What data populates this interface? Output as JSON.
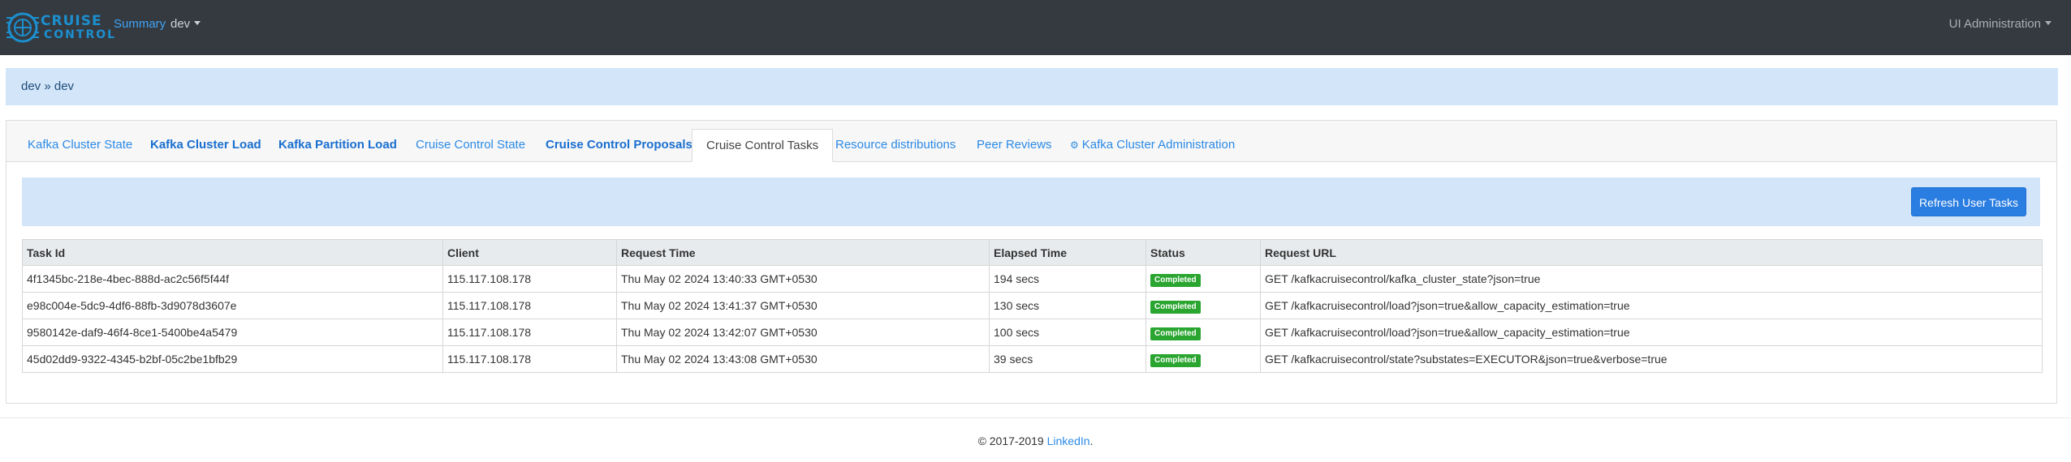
{
  "navbar": {
    "logo_line1": "CRUISE",
    "logo_line2": "CONTROL",
    "summary": "Summary",
    "env": "dev",
    "admin": "UI Administration"
  },
  "breadcrumb": "dev » dev",
  "tabs": [
    {
      "label": "Kafka Cluster State"
    },
    {
      "label": "Kafka Cluster Load"
    },
    {
      "label": "Kafka Partition Load"
    },
    {
      "label": "Cruise Control State"
    },
    {
      "label": "Cruise Control Proposals"
    },
    {
      "label": "Cruise Control Tasks"
    },
    {
      "label": "Resource distributions"
    },
    {
      "label": "Peer Reviews"
    },
    {
      "label": "Kafka Cluster Administration",
      "icon": "gear-icon"
    }
  ],
  "toolbar": {
    "refresh_label": "Refresh User Tasks"
  },
  "table": {
    "headers": [
      "Task Id",
      "Client",
      "Request Time",
      "Elapsed Time",
      "Status",
      "Request URL"
    ],
    "rows": [
      [
        "4f1345bc-218e-4bec-888d-ac2c56f5f44f",
        "115.117.108.178",
        "Thu May 02 2024 13:40:33 GMT+0530",
        "194 secs",
        "Completed",
        "GET /kafkacruisecontrol/kafka_cluster_state?json=true"
      ],
      [
        "e98c004e-5dc9-4df6-88fb-3d9078d3607e",
        "115.117.108.178",
        "Thu May 02 2024 13:41:37 GMT+0530",
        "130 secs",
        "Completed",
        "GET /kafkacruisecontrol/load?json=true&allow_capacity_estimation=true"
      ],
      [
        "9580142e-daf9-46f4-8ce1-5400be4a5479",
        "115.117.108.178",
        "Thu May 02 2024 13:42:07 GMT+0530",
        "100 secs",
        "Completed",
        "GET /kafkacruisecontrol/load?json=true&allow_capacity_estimation=true"
      ],
      [
        "45d02dd9-9322-4345-b2bf-05c2be1bfb29",
        "115.117.108.178",
        "Thu May 02 2024 13:43:08 GMT+0530",
        "39 secs",
        "Completed",
        "GET /kafkacruisecontrol/state?substates=EXECUTOR&json=true&verbose=true"
      ]
    ]
  },
  "footer": {
    "copyright": "© 2017-2019 ",
    "link": "LinkedIn",
    "period": "."
  },
  "colors": {
    "navbar": "#343a40",
    "accent": "#2c8ae6",
    "badge": "#2aa530",
    "breadcrumb_bg": "#d3e5f8"
  }
}
